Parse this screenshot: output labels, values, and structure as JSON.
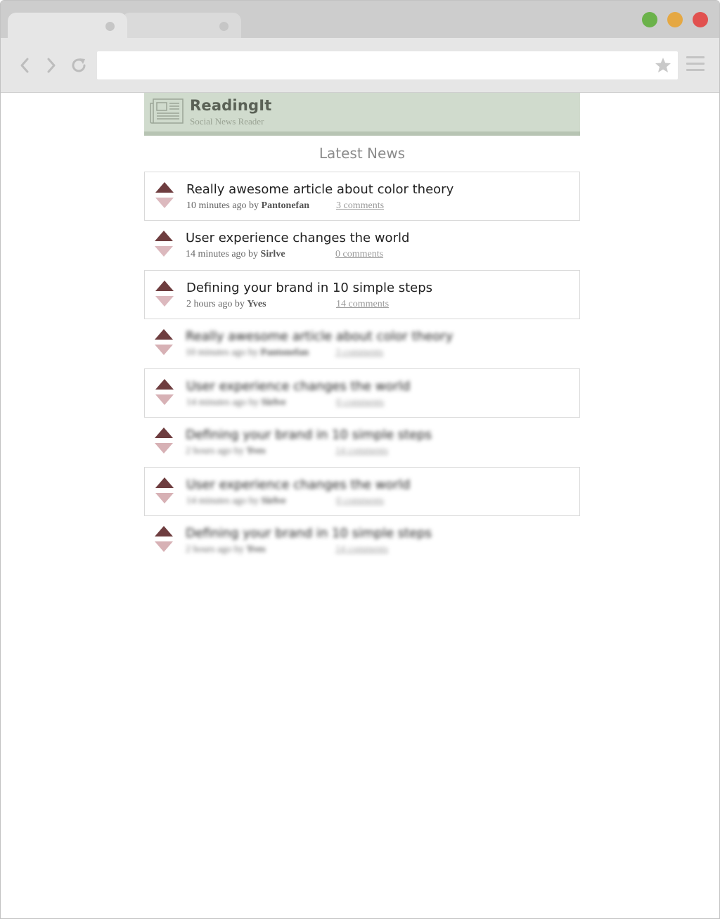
{
  "browser": {
    "url": "",
    "tabs": [
      {
        "state": "active"
      },
      {
        "state": "inactive"
      }
    ],
    "colors": {
      "close": "#e1514f",
      "minimize": "#e5a843",
      "maximize": "#6bb24a"
    }
  },
  "app": {
    "name": "ReadingIt",
    "tagline": "Social News Reader",
    "section_title": "Latest News",
    "colors": {
      "header_bg": "#d0dbcd",
      "upvote": "#6e3d3f",
      "downvote": "#dcb9be"
    }
  },
  "news": [
    {
      "title": "Really awesome article about color theory",
      "age": "10 minutes ago",
      "by": "by",
      "author": "Pantonefan",
      "comments": "3 comments",
      "bordered": true,
      "blurred": false
    },
    {
      "title": "User experience changes the world",
      "age": "14 minutes ago",
      "by": "by",
      "author": "Sirlve",
      "comments": "0 comments",
      "bordered": false,
      "blurred": false
    },
    {
      "title": "Defining your brand in 10 simple steps",
      "age": "2 hours ago",
      "by": "by",
      "author": "Yves",
      "comments": "14 comments",
      "bordered": true,
      "blurred": false
    },
    {
      "title": "Really awesome article about color theory",
      "age": "10 minutes ago",
      "by": "by",
      "author": "Pantonefan",
      "comments": "3 comments",
      "bordered": false,
      "blurred": true
    },
    {
      "title": "User experience changes the world",
      "age": "14 minutes ago",
      "by": "by",
      "author": "Sirlve",
      "comments": "0 comments",
      "bordered": true,
      "blurred": true
    },
    {
      "title": "Defining your brand in 10 simple steps",
      "age": "2 hours ago",
      "by": "by",
      "author": "Yves",
      "comments": "14 comments",
      "bordered": false,
      "blurred": true
    },
    {
      "title": "User experience changes the world",
      "age": "14 minutes ago",
      "by": "by",
      "author": "Sirlve",
      "comments": "0 comments",
      "bordered": true,
      "blurred": true
    },
    {
      "title": "Defining your brand in 10 simple steps",
      "age": "2 hours ago",
      "by": "by",
      "author": "Yves",
      "comments": "14 comments",
      "bordered": false,
      "blurred": true
    }
  ]
}
